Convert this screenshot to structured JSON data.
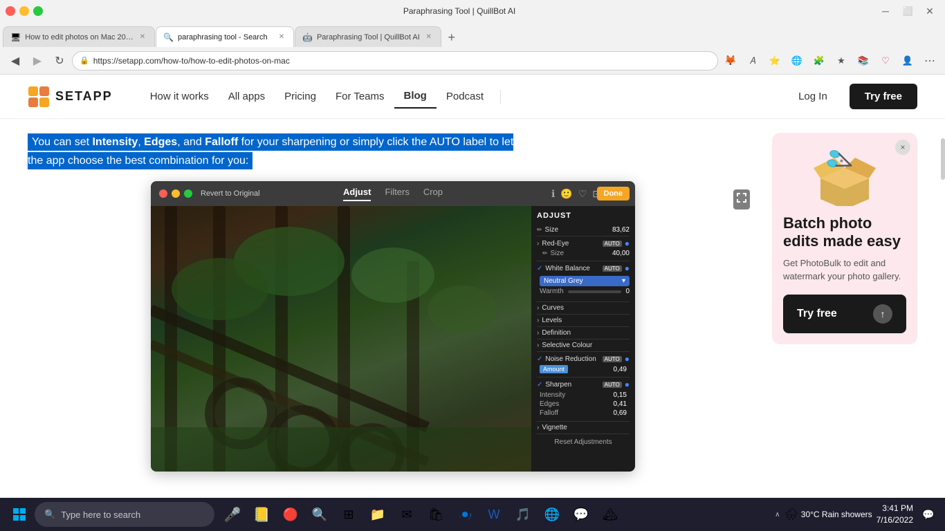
{
  "browser": {
    "tabs": [
      {
        "id": "tab1",
        "title": "How to edit photos on Mac 202...",
        "favicon": "🖥",
        "active": false,
        "url": ""
      },
      {
        "id": "tab2",
        "title": "paraphrasing tool - Search",
        "favicon": "🔍",
        "active": false,
        "url": ""
      },
      {
        "id": "tab3",
        "title": "Paraphrasing Tool | QuillBot AI",
        "favicon": "🤖",
        "active": true,
        "url": ""
      }
    ],
    "address": "https://setapp.com/how-to/how-to-edit-photos-on-mac",
    "add_tab_label": "+"
  },
  "header": {
    "logo_text": "SETAPP",
    "nav": {
      "how_it_works": "How it works",
      "all_apps": "All apps",
      "pricing": "Pricing",
      "for_teams": "For Teams",
      "blog": "Blog",
      "podcast": "Podcast"
    },
    "log_in": "Log In",
    "try_free": "Try free"
  },
  "article": {
    "highlighted_paragraph": "You can set Intensity, Edges, and Falloff for your sharpening or simply click the AUTO label to let the app choose the best combination for you:"
  },
  "mac_app": {
    "titlebar": {
      "revert_label": "Revert to Original",
      "tabs": [
        "Adjust",
        "Filters",
        "Crop"
      ],
      "done_label": "Done"
    },
    "adjust_panel": {
      "header": "ADJUST",
      "sections": [
        {
          "name": "Size",
          "value": "83,62"
        },
        {
          "name": "Red-Eye",
          "value": "",
          "sub": [
            {
              "name": "Size",
              "value": "40,00"
            }
          ]
        },
        {
          "name": "White Balance",
          "value": "Neutral Grey",
          "warmth": "0"
        },
        {
          "name": "Curves",
          "value": ""
        },
        {
          "name": "Levels",
          "value": ""
        },
        {
          "name": "Definition",
          "value": ""
        },
        {
          "name": "Selective Colour",
          "value": ""
        },
        {
          "name": "Noise Reduction",
          "amount": "Amount",
          "amount_val": "0,49"
        },
        {
          "name": "Sharpen",
          "intensity": "0,15",
          "edges": "0,41",
          "falloff": "0,69"
        },
        {
          "name": "Vignette",
          "value": ""
        }
      ],
      "reset_label": "Reset Adjustments"
    }
  },
  "sidebar_ad": {
    "title": "Batch photo edits made easy",
    "description": "Get PhotoBulk to edit and watermark your photo gallery.",
    "cta": "Try free",
    "close_label": "×"
  },
  "taskbar": {
    "search_placeholder": "Type here to search",
    "weather": "30°C  Rain showers",
    "time": "3:41 PM",
    "date": "7/16/2022"
  }
}
